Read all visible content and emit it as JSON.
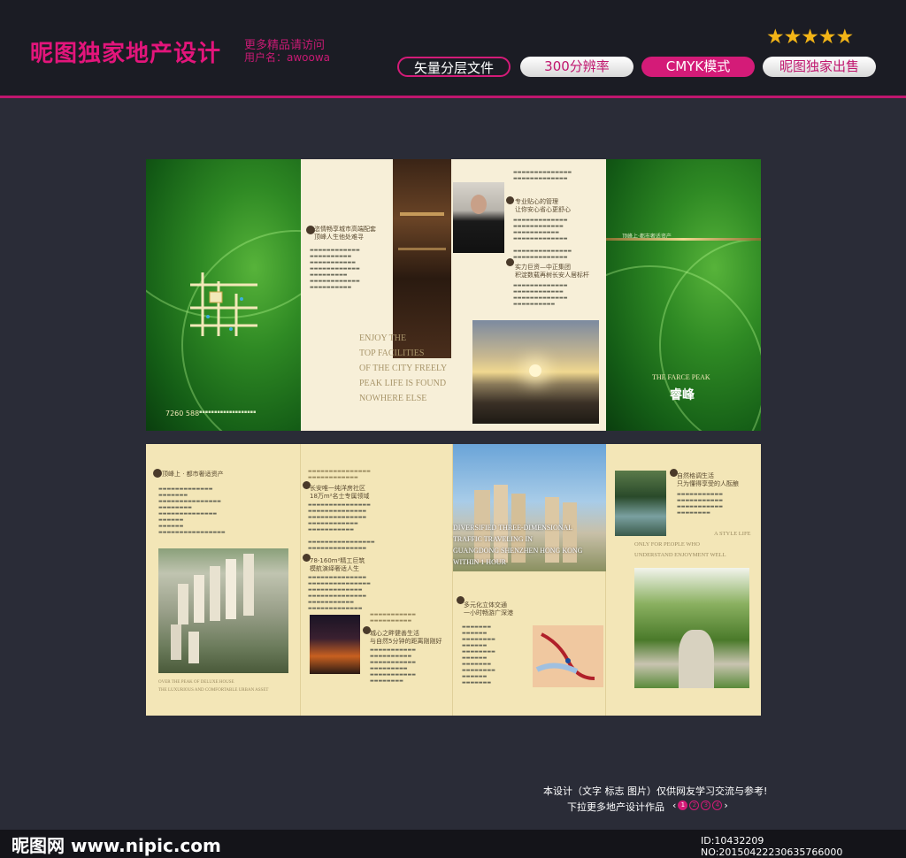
{
  "header": {
    "title": "昵图独家地产设计",
    "subtitle1": "更多精品请访问",
    "subtitle2": "用户名：awoowa",
    "stars": "★★★★★",
    "badges": [
      "矢量分层文件",
      "300分辨率",
      "CMYK模式",
      "昵图独家出售"
    ]
  },
  "brochure_top": {
    "phone": "7260 588",
    "panel2_heading": [
      "恣情畅享城市高端配套",
      "顶峰人生他处难寻"
    ],
    "slogan": [
      "ENJOY THE",
      "TOP FACILITIES",
      "OF THE CITY FREELY",
      "PEAK LIFE IS FOUND",
      "NOWHERE ELSE"
    ],
    "panel3_heading1": [
      "专业贴心的管理",
      "让你安心省心更舒心"
    ],
    "panel3_heading2": [
      "实力巨资—中正集团",
      "积淀数载再树长安人居标杆"
    ],
    "cover_tagline": "顶峰上·都市奢适资产",
    "cover_en": "THE FARCE PEAK",
    "cover_cn": "睿峰"
  },
  "brochure_bottom": {
    "p1_heading": "顶峰上 · 都市奢适资产",
    "p1_en": [
      "OVER THE PEAK OF DELUXE HOUSE",
      "THE LUXURIOUS AND COMFORTABLE URBAN ASSET"
    ],
    "p2_heading1": [
      "长安唯一纯洋房社区",
      "18万m²名士专属领域"
    ],
    "p2_heading2": [
      "78-160m²精工巨筑",
      "模航演绎奢适人生"
    ],
    "p2_heading3": [
      "城心之畔健善生活",
      "与自然5分钟的距离刚刚好"
    ],
    "p3_overlay": [
      "DIVERSIFIED THREE-DIMENSIONAL",
      "TRAFFIC TRAVELING IN",
      "GUANGDONG SHENZHEN HONG KONG",
      "WITHIN 1 HOUR"
    ],
    "p3_heading": [
      "多元化立体交通",
      "一小时畅游广深港"
    ],
    "p4_heading": [
      "自然格调生活",
      "只为懂得享受的人酝酿"
    ],
    "p4_en": [
      "A STYLE LIFE",
      "ONLY FOR PEOPLE WHO",
      "UNDERSTAND ENJOYMENT WELL"
    ]
  },
  "footer": {
    "line1": "本设计（文字 标志 图片）仅供网友学习交流与参考!",
    "line2": "下拉更多地产设计作品",
    "pages": [
      "1",
      "2",
      "3",
      "4"
    ],
    "logo": "昵图网 www.nipic.com",
    "id": "ID:10432209 NO:20150422230635766000"
  },
  "colors": {
    "accent": "#d41b78",
    "background": "#2a2c37",
    "cream": "#f3e6b7",
    "green": "#2f8a24"
  }
}
